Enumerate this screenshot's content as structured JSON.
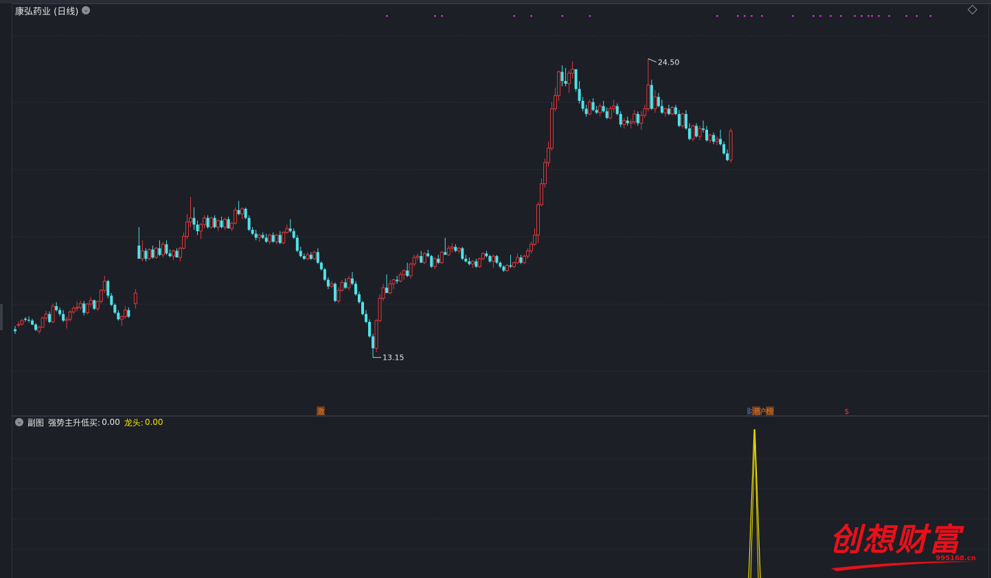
{
  "window": {
    "stock_title": "康弘药业 (日线)",
    "sub_label": "副图",
    "indicator_name": "强势主升低买:",
    "indicator_value": "0.00",
    "dragon_label": "龙头:",
    "dragon_value": "0.00"
  },
  "watermark": {
    "text": "创想财富",
    "url": "995168.cn"
  },
  "colors": {
    "up": "#e0393b",
    "down": "#4ee3ea",
    "signal_dot": "#d62dd6",
    "indicator_line": "#f5e400",
    "background": "#1c1f26",
    "grid": "#3a3e48"
  },
  "chart_data": [
    {
      "type": "candlestick",
      "ylim": [
        11.5,
        26.0
      ],
      "grid": true,
      "high_marker": "24.50",
      "low_marker": "13.15",
      "annotations": [
        "激",
        "财",
        "港",
        "沪",
        "榜",
        "$"
      ],
      "ohlc_note": "OHLC values approximated from the candle shapes",
      "candles": [
        [
          14.22,
          14.35,
          14.05,
          14.15
        ],
        [
          14.38,
          14.52,
          14.3,
          14.4
        ],
        [
          14.42,
          14.61,
          14.36,
          14.55
        ],
        [
          14.62,
          14.68,
          14.51,
          14.58
        ],
        [
          14.58,
          14.71,
          14.48,
          14.55
        ],
        [
          14.55,
          14.62,
          14.38,
          14.4
        ],
        [
          14.4,
          14.45,
          14.15,
          14.2
        ],
        [
          14.15,
          14.35,
          14.05,
          14.3
        ],
        [
          14.3,
          14.7,
          14.28,
          14.65
        ],
        [
          14.65,
          14.92,
          14.55,
          14.8
        ],
        [
          14.8,
          14.9,
          14.45,
          14.5
        ],
        [
          14.5,
          15.2,
          14.45,
          15.1
        ],
        [
          15.1,
          15.25,
          14.9,
          14.95
        ],
        [
          14.95,
          15.05,
          14.72,
          14.8
        ],
        [
          14.8,
          14.95,
          14.5,
          14.55
        ],
        [
          14.55,
          14.7,
          14.25,
          14.6
        ],
        [
          14.6,
          14.95,
          14.52,
          14.88
        ],
        [
          14.88,
          15.1,
          14.8,
          15.02
        ],
        [
          15.02,
          15.28,
          14.9,
          15.05
        ],
        [
          15.05,
          15.3,
          14.95,
          15.2
        ],
        [
          15.2,
          15.3,
          14.75,
          14.85
        ],
        [
          14.85,
          15.22,
          14.78,
          15.18
        ],
        [
          15.18,
          15.45,
          15.08,
          15.32
        ],
        [
          15.32,
          15.35,
          14.95,
          15.0
        ],
        [
          15.0,
          15.3,
          14.92,
          15.28
        ],
        [
          15.28,
          15.75,
          15.2,
          15.7
        ],
        [
          15.7,
          16.25,
          15.6,
          16.05
        ],
        [
          16.05,
          16.1,
          15.4,
          15.5
        ],
        [
          15.5,
          15.6,
          15.1,
          15.15
        ],
        [
          15.15,
          15.2,
          14.8,
          14.85
        ],
        [
          14.85,
          14.95,
          14.55,
          14.6
        ],
        [
          14.6,
          14.75,
          14.35,
          14.7
        ],
        [
          14.7,
          15.1,
          14.62,
          14.95
        ],
        [
          14.95,
          15.05,
          14.65,
          14.7
        ],
        null,
        [
          15.2,
          15.75,
          15.0,
          15.6
        ],
        [
          17.4,
          18.1,
          17.2,
          16.9
        ],
        [
          16.9,
          17.6,
          16.8,
          17.2
        ],
        [
          17.2,
          17.3,
          16.8,
          16.9
        ],
        [
          16.9,
          17.3,
          16.85,
          17.25
        ],
        [
          17.25,
          17.4,
          16.9,
          16.95
        ],
        [
          16.95,
          17.35,
          16.9,
          17.3
        ],
        [
          17.3,
          17.6,
          17.0,
          17.05
        ],
        [
          17.05,
          17.55,
          16.95,
          17.45
        ],
        [
          17.45,
          17.6,
          17.05,
          17.1
        ],
        [
          17.1,
          17.25,
          16.95,
          17.0
        ],
        [
          17.0,
          17.25,
          16.85,
          17.2
        ],
        [
          17.2,
          17.3,
          16.95,
          16.95
        ],
        [
          16.95,
          17.35,
          16.8,
          17.3
        ],
        [
          17.3,
          17.9,
          17.25,
          17.75
        ],
        [
          17.75,
          18.6,
          17.65,
          18.3
        ],
        [
          18.3,
          19.25,
          18.1,
          18.45
        ],
        [
          18.45,
          18.85,
          18.0,
          18.2
        ],
        [
          18.2,
          18.35,
          17.8,
          17.95
        ],
        [
          17.95,
          18.25,
          17.65,
          18.2
        ],
        [
          18.2,
          18.55,
          18.05,
          18.45
        ],
        [
          18.45,
          18.55,
          18.05,
          18.1
        ],
        [
          18.1,
          18.5,
          18.05,
          18.45
        ],
        [
          18.45,
          18.55,
          18.05,
          18.1
        ],
        [
          18.1,
          18.4,
          17.95,
          18.35
        ],
        [
          18.35,
          18.5,
          18.05,
          18.1
        ],
        [
          18.1,
          18.45,
          18.0,
          18.4
        ],
        [
          18.4,
          18.5,
          18.05,
          18.05
        ],
        [
          18.05,
          18.3,
          17.95,
          18.25
        ],
        [
          18.25,
          18.85,
          18.2,
          18.75
        ],
        [
          18.75,
          19.1,
          18.55,
          18.6
        ],
        [
          18.6,
          18.85,
          18.4,
          18.8
        ],
        [
          18.8,
          18.85,
          18.4,
          18.45
        ],
        [
          18.45,
          18.55,
          17.95,
          18.0
        ],
        [
          18.0,
          18.1,
          17.8,
          17.85
        ],
        [
          17.85,
          18.0,
          17.6,
          17.7
        ],
        [
          17.7,
          17.85,
          17.55,
          17.8
        ],
        [
          17.8,
          17.9,
          17.65,
          17.7
        ],
        [
          17.7,
          17.85,
          17.5,
          17.55
        ],
        [
          17.55,
          17.85,
          17.45,
          17.8
        ],
        [
          17.8,
          17.9,
          17.5,
          17.55
        ],
        [
          17.55,
          17.85,
          17.45,
          17.8
        ],
        [
          17.8,
          17.95,
          17.45,
          17.5
        ],
        [
          17.5,
          17.95,
          17.45,
          17.9
        ],
        [
          17.9,
          18.2,
          17.85,
          18.05
        ],
        [
          18.05,
          18.4,
          17.9,
          17.95
        ],
        [
          17.95,
          18.05,
          17.65,
          17.7
        ],
        [
          17.7,
          17.8,
          17.15,
          17.2
        ],
        [
          17.2,
          17.35,
          16.95,
          17.0
        ],
        [
          17.0,
          17.1,
          16.85,
          16.9
        ],
        [
          16.9,
          17.15,
          16.85,
          17.05
        ],
        [
          17.05,
          17.15,
          16.85,
          16.9
        ],
        [
          16.9,
          17.2,
          16.85,
          17.15
        ],
        [
          17.15,
          17.3,
          16.7,
          16.75
        ],
        [
          16.75,
          16.8,
          16.45,
          16.5
        ],
        [
          16.5,
          16.55,
          16.05,
          16.1
        ],
        [
          16.1,
          16.2,
          15.75,
          15.85
        ],
        [
          15.85,
          16.05,
          15.8,
          15.95
        ],
        [
          15.95,
          16.0,
          15.25,
          15.3
        ],
        [
          15.3,
          15.8,
          15.2,
          15.7
        ],
        [
          15.7,
          16.1,
          15.65,
          16.0
        ],
        [
          16.0,
          16.15,
          15.75,
          15.8
        ],
        [
          15.8,
          16.25,
          15.7,
          16.15
        ],
        [
          16.15,
          16.4,
          15.9,
          15.95
        ],
        [
          15.95,
          16.05,
          15.5,
          15.55
        ],
        [
          15.55,
          15.65,
          15.2,
          15.25
        ],
        [
          15.25,
          15.3,
          14.75,
          14.8
        ],
        [
          14.8,
          14.95,
          14.45,
          14.5
        ],
        [
          14.5,
          14.6,
          13.9,
          13.95
        ],
        [
          13.95,
          14.05,
          13.15,
          13.5
        ],
        [
          13.5,
          14.6,
          13.35,
          14.55
        ],
        [
          14.55,
          15.55,
          14.5,
          15.4
        ],
        [
          15.4,
          15.95,
          15.3,
          15.8
        ],
        [
          15.8,
          16.3,
          15.7,
          15.6
        ],
        [
          15.6,
          16.1,
          15.55,
          15.95
        ],
        [
          15.95,
          16.15,
          15.75,
          16.1
        ],
        [
          16.1,
          16.25,
          15.95,
          16.05
        ],
        [
          16.05,
          16.4,
          16.0,
          16.3
        ],
        [
          16.3,
          16.5,
          16.1,
          16.45
        ],
        [
          16.45,
          16.75,
          16.2,
          16.25
        ],
        [
          16.25,
          16.75,
          16.15,
          16.7
        ],
        [
          16.7,
          17.05,
          16.6,
          16.95
        ],
        [
          16.95,
          17.1,
          16.85,
          17.0
        ],
        [
          17.0,
          17.2,
          16.95,
          16.75
        ],
        [
          16.75,
          17.15,
          16.7,
          17.1
        ],
        [
          17.1,
          17.25,
          16.95,
          17.0
        ],
        [
          17.0,
          17.05,
          16.55,
          16.6
        ],
        [
          16.6,
          16.95,
          16.5,
          16.9
        ],
        [
          16.9,
          17.05,
          16.7,
          16.75
        ],
        [
          16.75,
          17.2,
          16.7,
          17.15
        ],
        [
          17.15,
          17.7,
          17.1,
          17.05
        ],
        [
          17.05,
          17.4,
          17.0,
          17.3
        ],
        [
          17.3,
          17.5,
          17.15,
          17.35
        ],
        [
          17.35,
          17.45,
          17.15,
          17.2
        ],
        [
          17.2,
          17.35,
          17.1,
          17.3
        ],
        [
          17.3,
          17.35,
          16.85,
          16.9
        ],
        [
          16.9,
          17.05,
          16.75,
          16.8
        ],
        [
          16.8,
          16.95,
          16.65,
          16.7
        ],
        [
          16.7,
          16.85,
          16.55,
          16.8
        ],
        [
          16.8,
          16.9,
          16.55,
          16.6
        ],
        [
          16.6,
          16.95,
          16.55,
          16.9
        ],
        [
          16.9,
          17.15,
          16.85,
          17.1
        ],
        [
          17.1,
          17.2,
          16.95,
          17.0
        ],
        [
          17.0,
          17.05,
          16.75,
          16.8
        ],
        [
          16.8,
          17.05,
          16.55,
          17.0
        ],
        [
          17.0,
          17.05,
          16.7,
          16.75
        ],
        [
          16.75,
          16.8,
          16.55,
          16.6
        ],
        [
          16.6,
          16.65,
          16.4,
          16.45
        ],
        [
          16.45,
          16.7,
          16.4,
          16.65
        ],
        [
          16.65,
          17.05,
          16.55,
          16.6
        ],
        [
          16.6,
          16.8,
          16.55,
          16.75
        ],
        [
          16.75,
          17.1,
          16.7,
          16.95
        ],
        [
          16.95,
          17.05,
          16.7,
          16.75
        ],
        [
          16.75,
          17.05,
          16.7,
          17.0
        ],
        [
          17.0,
          17.3,
          16.9,
          17.2
        ],
        [
          17.2,
          17.55,
          17.1,
          17.45
        ],
        [
          17.45,
          18.05,
          17.4,
          17.8
        ],
        [
          17.8,
          19.05,
          17.5,
          18.95
        ],
        [
          18.95,
          19.95,
          18.9,
          19.75
        ],
        [
          19.75,
          20.7,
          19.6,
          20.55
        ],
        [
          20.55,
          21.35,
          20.4,
          21.1
        ],
        [
          21.1,
          22.85,
          21.0,
          22.6
        ],
        [
          22.6,
          23.4,
          22.5,
          23.1
        ],
        [
          23.1,
          24.05,
          22.9,
          24.0
        ],
        [
          24.0,
          24.25,
          23.45,
          23.65
        ],
        [
          23.65,
          24.15,
          23.45,
          23.55
        ],
        [
          23.55,
          24.05,
          23.2,
          23.95
        ],
        [
          23.95,
          24.4,
          23.75,
          24.1
        ],
        [
          24.1,
          24.05,
          23.25,
          23.35
        ],
        [
          23.35,
          23.65,
          22.8,
          22.9
        ],
        [
          22.9,
          23.05,
          22.5,
          22.6
        ],
        [
          22.6,
          22.75,
          22.3,
          22.4
        ],
        [
          22.4,
          22.95,
          22.35,
          22.85
        ],
        [
          22.85,
          23.0,
          22.5,
          22.55
        ],
        [
          22.55,
          22.7,
          22.4,
          22.45
        ],
        [
          22.45,
          22.8,
          22.3,
          22.7
        ],
        [
          22.7,
          22.9,
          22.45,
          22.5
        ],
        [
          22.5,
          22.65,
          22.2,
          22.25
        ],
        [
          22.25,
          22.7,
          22.2,
          22.6
        ],
        [
          22.6,
          22.95,
          22.45,
          22.7
        ],
        [
          22.7,
          22.8,
          22.35,
          22.4
        ],
        [
          22.4,
          22.5,
          21.9,
          22.0
        ],
        [
          22.0,
          22.25,
          21.85,
          22.15
        ],
        [
          22.15,
          22.3,
          21.95,
          22.05
        ],
        [
          22.05,
          22.2,
          21.85,
          22.1
        ],
        [
          22.1,
          22.55,
          22.0,
          22.4
        ],
        [
          22.4,
          22.5,
          21.95,
          22.05
        ],
        [
          22.05,
          22.5,
          21.8,
          22.35
        ],
        [
          22.35,
          22.75,
          22.25,
          22.6
        ],
        [
          22.6,
          24.5,
          22.5,
          23.5
        ],
        [
          23.5,
          23.7,
          22.55,
          22.6
        ],
        [
          22.6,
          23.3,
          22.45,
          23.05
        ],
        [
          23.05,
          23.2,
          22.65,
          22.7
        ],
        [
          22.7,
          22.95,
          22.4,
          22.45
        ],
        [
          22.45,
          22.65,
          22.3,
          22.6
        ],
        [
          22.6,
          22.75,
          22.35,
          22.4
        ],
        [
          22.4,
          22.7,
          22.35,
          22.65
        ],
        [
          22.65,
          22.75,
          22.35,
          22.4
        ],
        [
          22.4,
          22.55,
          21.9,
          21.95
        ],
        [
          21.95,
          22.45,
          21.85,
          22.4
        ],
        [
          22.4,
          22.55,
          21.8,
          21.85
        ],
        [
          21.85,
          22.05,
          21.4,
          21.45
        ],
        [
          21.45,
          22.0,
          21.35,
          21.95
        ],
        [
          21.95,
          22.05,
          21.5,
          21.55
        ],
        [
          21.55,
          21.95,
          21.4,
          21.85
        ],
        [
          21.85,
          22.15,
          21.7,
          21.8
        ],
        [
          21.8,
          21.95,
          21.35,
          21.4
        ],
        [
          21.4,
          21.65,
          21.3,
          21.6
        ],
        [
          21.6,
          21.7,
          21.25,
          21.35
        ],
        [
          21.35,
          21.55,
          21.2,
          21.45
        ],
        [
          21.45,
          21.8,
          21.2,
          21.25
        ],
        [
          21.25,
          21.35,
          20.85,
          20.9
        ],
        [
          20.9,
          21.05,
          20.6,
          20.65
        ],
        [
          20.65,
          21.85,
          20.55,
          21.75
        ]
      ],
      "signal_dots_rows": [
        {
          "row": "top",
          "indices": [
            108,
            122,
            124,
            145,
            150,
            159,
            167,
            204,
            210,
            212,
            214,
            217,
            226,
            232,
            234,
            237,
            240,
            244,
            246,
            248,
            249,
            251,
            254,
            259,
            262,
            266
          ]
        }
      ]
    },
    {
      "type": "line",
      "series": [
        {
          "name": "龙头",
          "peak_index": 215,
          "values_note": "zero everywhere except a single spike at peak_index"
        }
      ],
      "ylim": [
        0,
        1
      ],
      "grid": true
    }
  ]
}
